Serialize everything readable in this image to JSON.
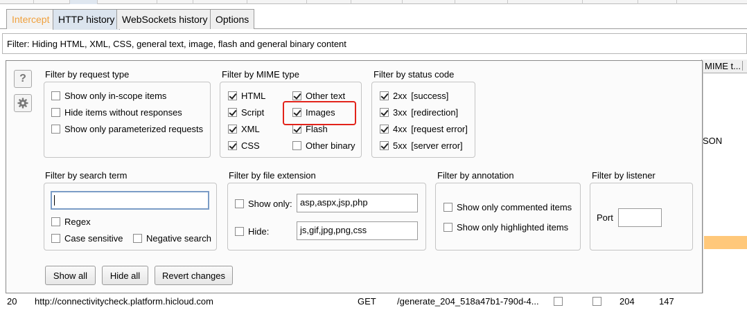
{
  "tabs": {
    "intercept": "Intercept",
    "http_history": "HTTP history",
    "websockets_history": "WebSockets history",
    "options": "Options"
  },
  "filter_bar": "Filter: Hiding HTML, XML, CSS, general text, image, flash and general binary content",
  "background": {
    "mime_header": "MIME t...",
    "json_fragment": "SON"
  },
  "panel": {
    "help_icon": "?",
    "request_type": {
      "title": "Filter by request type",
      "items": [
        {
          "label": "Show only in-scope items",
          "checked": false
        },
        {
          "label": "Hide items without responses",
          "checked": false
        },
        {
          "label": "Show only parameterized requests",
          "checked": false
        }
      ]
    },
    "mime_type": {
      "title": "Filter by MIME type",
      "col1": [
        {
          "label": "HTML",
          "checked": true
        },
        {
          "label": "Script",
          "checked": true
        },
        {
          "label": "XML",
          "checked": true
        },
        {
          "label": "CSS",
          "checked": true
        }
      ],
      "col2": [
        {
          "label": "Other text",
          "checked": true
        },
        {
          "label": "Images",
          "checked": true
        },
        {
          "label": "Flash",
          "checked": true
        },
        {
          "label": "Other binary",
          "checked": false
        }
      ]
    },
    "status_code": {
      "title": "Filter by status code",
      "items": [
        {
          "code": "2xx",
          "desc": "[success]",
          "checked": true
        },
        {
          "code": "3xx",
          "desc": "[redirection]",
          "checked": true
        },
        {
          "code": "4xx",
          "desc": "[request error]",
          "checked": true
        },
        {
          "code": "5xx",
          "desc": "[server error]",
          "checked": true
        }
      ]
    },
    "search_term": {
      "title": "Filter by search term",
      "value": "",
      "regex": "Regex",
      "case_sensitive": "Case sensitive",
      "negative_search": "Negative search"
    },
    "file_extension": {
      "title": "Filter by file extension",
      "show_only_label": "Show only:",
      "show_only_value": "asp,aspx,jsp,php",
      "hide_label": "Hide:",
      "hide_value": "js,gif,jpg,png,css"
    },
    "annotation": {
      "title": "Filter by annotation",
      "commented": "Show only commented items",
      "highlighted": "Show only highlighted items"
    },
    "listener": {
      "title": "Filter by listener",
      "port_label": "Port",
      "port_value": ""
    },
    "buttons": {
      "show_all": "Show all",
      "hide_all": "Hide all",
      "revert": "Revert changes"
    }
  },
  "bottom_row": {
    "index": "20",
    "host": "http://connectivitycheck.platform.hicloud.com",
    "method": "GET",
    "url": "/generate_204_518a47b1-790d-4...",
    "status": "204",
    "length": "147"
  }
}
